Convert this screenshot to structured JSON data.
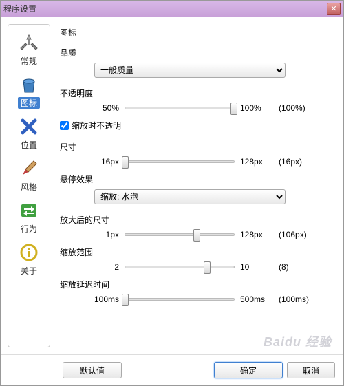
{
  "window": {
    "title": "程序设置"
  },
  "sidebar": {
    "items": [
      {
        "label": "常规"
      },
      {
        "label": "图标"
      },
      {
        "label": "位置"
      },
      {
        "label": "风格"
      },
      {
        "label": "行为"
      },
      {
        "label": "关于"
      }
    ]
  },
  "main": {
    "title": "图标",
    "quality": {
      "label": "品质",
      "selected": "一般质量"
    },
    "opacity": {
      "label": "不透明度",
      "min": "50%",
      "max": "100%",
      "value": "(100%)",
      "pos": 100
    },
    "checkbox": {
      "label": "缩放时不透明"
    },
    "size": {
      "label": "尺寸",
      "min": "16px",
      "max": "128px",
      "value": "(16px)",
      "pos": 0
    },
    "hover": {
      "label": "悬停效果",
      "selected": "缩放: 水泡"
    },
    "zoomed": {
      "label": "放大后的尺寸",
      "min": "1px",
      "max": "128px",
      "value": "(106px)",
      "pos": 66
    },
    "range": {
      "label": "缩放范围",
      "min": "2",
      "max": "10",
      "value": "(8)",
      "pos": 75
    },
    "delay": {
      "label": "缩放延迟时间",
      "min": "100ms",
      "max": "500ms",
      "value": "(100ms)",
      "pos": 0
    }
  },
  "footer": {
    "default": "默认值",
    "ok": "确定",
    "cancel": "取消"
  },
  "watermark": "Baidu 经验"
}
